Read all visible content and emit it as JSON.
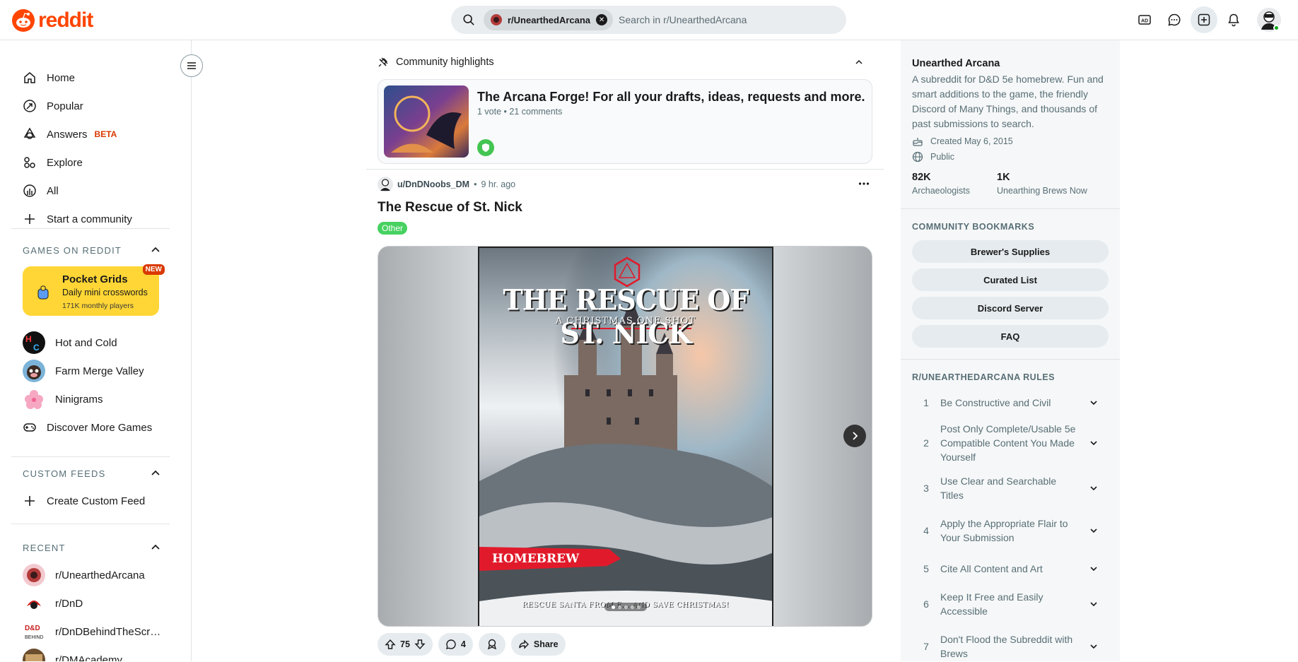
{
  "header": {
    "logo_text": "reddit",
    "search_chip": "r/UnearthedArcana",
    "search_placeholder": "Search in r/UnearthedArcana",
    "icons": [
      "advertise-icon",
      "chat-icon",
      "create-post-icon",
      "notifications-icon",
      "user-avatar"
    ]
  },
  "sidebar": {
    "nav": [
      {
        "label": "Home",
        "icon": "home-icon"
      },
      {
        "label": "Popular",
        "icon": "popular-icon"
      },
      {
        "label": "Answers",
        "icon": "answers-icon",
        "badge": "BETA"
      },
      {
        "label": "Explore",
        "icon": "explore-icon"
      },
      {
        "label": "All",
        "icon": "all-icon"
      },
      {
        "label": "Start a community",
        "icon": "plus-icon"
      }
    ],
    "games_heading": "GAMES ON REDDIT",
    "featured_game": {
      "title": "Pocket Grids",
      "subtitle": "Daily mini crosswords",
      "players": "171K monthly players",
      "badge": "NEW"
    },
    "games": [
      "Hot and Cold",
      "Farm Merge Valley",
      "Ninigrams",
      "Discover More Games"
    ],
    "custom_feeds_heading": "CUSTOM FEEDS",
    "create_feed": "Create Custom Feed",
    "recent_heading": "RECENT",
    "recent": [
      "r/UnearthedArcana",
      "r/DnD",
      "r/DnDBehindTheScr…",
      "r/DMAcademy"
    ]
  },
  "highlights": {
    "heading": "Community highlights",
    "card": {
      "title": "The Arcana Forge! For all your drafts, ideas, requests and more.",
      "meta": "1 vote • 21 comments"
    }
  },
  "post": {
    "author": "u/DnDNoobs_DM",
    "time": "9 hr. ago",
    "separator": "•",
    "title": "The Rescue of St. Nick",
    "flair": "Other",
    "image": {
      "title": "THE RESCUE OF ST. NICK",
      "subtitle": "A CHRISTMAS ONE SHOT",
      "banner": "HOMEBREW",
      "tagline": "RESCUE SANTA FROM E... AND SAVE CHRISTMAS!"
    },
    "votes": "75",
    "comments": "4",
    "share": "Share"
  },
  "community": {
    "name": "Unearthed Arcana",
    "description": "A subreddit for D&D 5e homebrew. Fun and smart additions to the game, the friendly Discord of Many Things, and thousands of past submissions to search.",
    "created": "Created May 6, 2015",
    "visibility": "Public",
    "members": "82K",
    "members_label": "Archaeologists",
    "online": "1K",
    "online_label": "Unearthing Brews Now",
    "bookmarks_heading": "COMMUNITY BOOKMARKS",
    "bookmarks": [
      "Brewer's Supplies",
      "Curated List",
      "Discord Server",
      "FAQ"
    ],
    "rules_heading": "R/UNEARTHEDARCANA RULES",
    "rules": [
      {
        "num": "1",
        "text": "Be Constructive and Civil"
      },
      {
        "num": "2",
        "text": "Post Only Complete/Usable 5e Compatible Content You Made Yourself"
      },
      {
        "num": "3",
        "text": "Use Clear and Searchable Titles"
      },
      {
        "num": "4",
        "text": "Apply the Appropriate Flair to Your Submission"
      },
      {
        "num": "5",
        "text": "Cite All Content and Art"
      },
      {
        "num": "6",
        "text": "Keep It Free and Easily Accessible"
      },
      {
        "num": "7",
        "text": "Don't Flood the Subreddit with Brews"
      }
    ]
  },
  "colors": {
    "brand": "#ff4500",
    "flair": "#46d160",
    "featured_game_bg": "#ffd635",
    "beta": "#d93900"
  }
}
